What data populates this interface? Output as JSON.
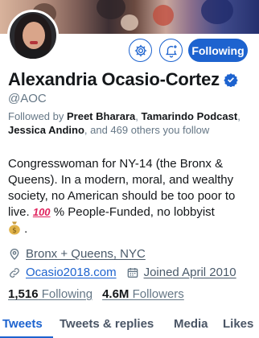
{
  "profile": {
    "name": "Alexandria Ocasio-Cortez",
    "handle": "@AOC",
    "verified": true
  },
  "actions": {
    "settings_icon": "gear-icon",
    "notify_icon": "bell-plus-icon",
    "following_label": "Following"
  },
  "followed_by": {
    "prefix": "Followed by ",
    "name1": "Preet Bharara",
    "sep1": ", ",
    "name2": "Tamarindo Podcast",
    "sep2": ", ",
    "name3": "Jessica Andino",
    "suffix": ", and 469 others you follow"
  },
  "bio": {
    "text": "Congresswoman for NY-14 (the Bronx & Queens). In a modern, moral, and wealthy society, no American should be too poor to live. ",
    "emoji_100": "100",
    "tail": " % People-Funded, no lobbyist",
    "end": " ."
  },
  "meta": {
    "location": "Bronx + Queens, NYC",
    "website": "Ocasio2018.com",
    "joined": "Joined April 2010"
  },
  "stats": {
    "following_count": "1,516",
    "following_label": " Following",
    "followers_count": "4.6M",
    "followers_label": " Followers"
  },
  "tabs": [
    {
      "label": "Tweets",
      "active": true
    },
    {
      "label": "Tweets & replies",
      "active": false
    },
    {
      "label": "Media",
      "active": false
    },
    {
      "label": "Likes",
      "active": false
    }
  ],
  "colors": {
    "accent": "#1d63cf",
    "text": "#14171a",
    "secondary": "#657786"
  }
}
